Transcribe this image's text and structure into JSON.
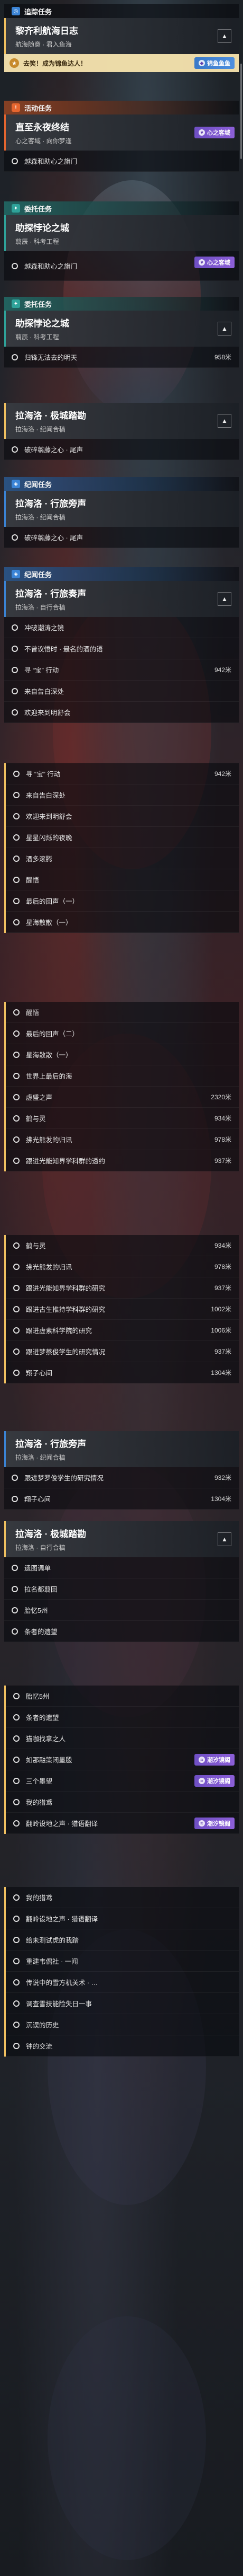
{
  "colors": {
    "accent_gold": "#f0c060",
    "header_orange": "#e6662f",
    "header_teal": "#2fa39a",
    "header_blue": "#3b84d6",
    "tag_purple": "#7c55d0",
    "tag_blue": "#4186d6"
  },
  "s1": {
    "header": "追踪任务",
    "title": "黎齐利航海日志",
    "sub": "航海随意 · 君入鱼海",
    "notice": "去笑！成为锦鱼达人！",
    "notice_tag": "锦鱼鱼鱼"
  },
  "s2": {
    "header": "活动任务",
    "title": "直至永夜终结",
    "sub": "心之客域 · 向你梦逢",
    "row1": "越森和助心之旗门",
    "tag": "心之客域"
  },
  "s3": {
    "header": "委托任务",
    "title": "助探悖论之城",
    "sub": "翦辰 · 科考工程",
    "row1": "越森和助心之旗门",
    "tag": "心之客域"
  },
  "s4": {
    "header": "委托任务",
    "title": "助探悖论之城",
    "sub": "翦辰 · 科考工程",
    "row1": "归锋无法去的明天",
    "row1_dist": "958米"
  },
  "s5": {
    "title": "拉海洛 · 极城踏勘",
    "sub": "拉海洛 · 纪闻合稿",
    "row1": "破碎翦藤之心 · 尾声"
  },
  "s6": {
    "header": "纪闻任务",
    "title": "拉海洛 · 行旅旁声",
    "sub": "拉海洛 · 纪闻合稿",
    "row1": "破碎翦藤之心 · 尾声"
  },
  "s7": {
    "header": "纪闻任务",
    "title": "拉海洛 · 行旅奏声",
    "sub": "拉海洛 · 自行合稿",
    "rows": [
      {
        "label": "冲破潮涛之镜",
        "dist": ""
      },
      {
        "label": "不曾议悟时 · 最名的酒的语",
        "dist": ""
      },
      {
        "label": "寻 “宝” 行动",
        "dist": "942米"
      },
      {
        "label": "来自告白深处",
        "dist": ""
      },
      {
        "label": "欢迎来到明舒会",
        "dist": ""
      }
    ]
  },
  "s8": {
    "rows": [
      {
        "label": "寻 “宝” 行动",
        "dist": "942米"
      },
      {
        "label": "来自告白深处",
        "dist": ""
      },
      {
        "label": "欢迎来到明舒会",
        "dist": ""
      },
      {
        "label": "星星闪烁的夜晚",
        "dist": ""
      },
      {
        "label": "酒多滚腾",
        "dist": ""
      },
      {
        "label": "醒悟",
        "dist": ""
      },
      {
        "label": "最后的回声（一）",
        "dist": ""
      },
      {
        "label": "星海散散（一）",
        "dist": ""
      }
    ]
  },
  "s9": {
    "rows": [
      {
        "label": "醒悟",
        "dist": ""
      },
      {
        "label": "最后的回声（二）",
        "dist": ""
      },
      {
        "label": "星海散散（一）",
        "dist": ""
      },
      {
        "label": "世界上最后的海",
        "dist": ""
      },
      {
        "label": "虚盛之声",
        "dist": "2320米"
      },
      {
        "label": "鹤与灵",
        "dist": "934米"
      },
      {
        "label": "拂光熊发的归讯",
        "dist": "978米"
      },
      {
        "label": "跟进光能知界学科群的透约",
        "dist": "937米"
      }
    ]
  },
  "s10": {
    "rows": [
      {
        "label": "鹤与灵",
        "dist": "934米"
      },
      {
        "label": "拂光熊发的归讯",
        "dist": "978米"
      },
      {
        "label": "跟进光能知界学科群的研究",
        "dist": "937米"
      },
      {
        "label": "跟进古生推持学科群的研究",
        "dist": "1002米"
      },
      {
        "label": "跟进虚素科学院的研究",
        "dist": "1006米"
      },
      {
        "label": "跟进梦蔡俊学生的研究情况",
        "dist": "937米"
      },
      {
        "label": "翔子心间",
        "dist": "1304米"
      }
    ]
  },
  "s11": {
    "title": "拉海洛 · 行旅旁声",
    "sub": "拉海洛 · 纪闻合稿",
    "row1": "跟进梦罗俊学生的研究情况",
    "row1_dist": "932米",
    "row2": "翔子心间",
    "row2_dist": "1304米"
  },
  "s12": {
    "title": "拉海洛 · 极城踏勘",
    "sub": "拉海洛 · 自行合稿",
    "rows": [
      {
        "label": "遗图调单",
        "tag": ""
      },
      {
        "label": "拉名都翦回",
        "tag": ""
      },
      {
        "label": "胎忆5州",
        "tag": ""
      },
      {
        "label": "条者的遗望",
        "tag": ""
      }
    ]
  },
  "s13": {
    "rows": [
      {
        "label": "胎忆5州",
        "tag": ""
      },
      {
        "label": "条者的遗望",
        "tag": ""
      },
      {
        "label": "猫咖找拿之人",
        "tag": ""
      },
      {
        "label": "如那融策闭墨殷",
        "tag": "潮汐镜阁"
      },
      {
        "label": "三个墨望",
        "tag": "潮汐镜阁"
      },
      {
        "label": "我的猎鸢",
        "tag": ""
      },
      {
        "label": "翻岭设地之声 · 猎语翻译",
        "tag": "潮汐镜阁"
      }
    ]
  },
  "s14": {
    "rows": [
      {
        "label": "我的猎鸢",
        "tag": ""
      },
      {
        "label": "翻岭设地之声 · 猎语翻译",
        "tag": ""
      },
      {
        "label": "给未测试虎的我踏",
        "tag": ""
      },
      {
        "label": "重建韦偶社 · 一闻",
        "tag": ""
      },
      {
        "label": "传说中的雪方机关术 · …",
        "tag": ""
      },
      {
        "label": "调查雪技能险失日一事",
        "tag": ""
      },
      {
        "label": "沉误的历史",
        "tag": ""
      },
      {
        "label": "钟的交流",
        "tag": ""
      }
    ]
  }
}
